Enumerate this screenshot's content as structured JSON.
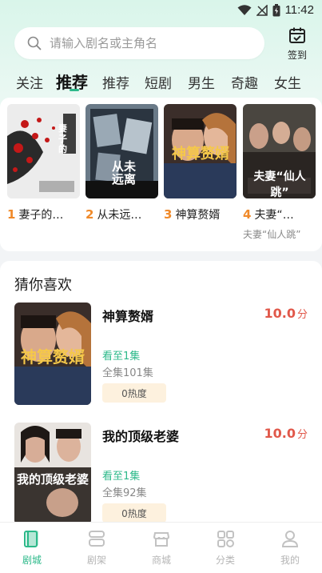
{
  "status": {
    "time": "11:42"
  },
  "search": {
    "placeholder": "请输入剧名或主角名"
  },
  "checkin": {
    "label": "签到"
  },
  "tabs": [
    {
      "label": "关注",
      "active": false
    },
    {
      "label": "推荐",
      "active": true
    },
    {
      "label": "推荐",
      "active": false
    },
    {
      "label": "短剧",
      "active": false
    },
    {
      "label": "男生",
      "active": false
    },
    {
      "label": "奇趣",
      "active": false
    },
    {
      "label": "女生",
      "active": false
    }
  ],
  "recommend": {
    "items": [
      {
        "rank": "1",
        "title": "妻子的…",
        "subtitle": "",
        "cover_text": "妻子的"
      },
      {
        "rank": "2",
        "title": "从未远…",
        "subtitle": "",
        "cover_text": "从未远离"
      },
      {
        "rank": "3",
        "title": "神算赘婿",
        "subtitle": "",
        "cover_text": "神算赘婿"
      },
      {
        "rank": "4",
        "title": "夫妻“…",
        "subtitle": "夫妻“仙人跳”",
        "cover_text": "夫妻“仙人跳”"
      }
    ]
  },
  "guess": {
    "title": "猜你喜欢",
    "items": [
      {
        "name": "神算赘婿",
        "score": "10.0",
        "score_unit": "分",
        "progress": "看至1集",
        "total": "全集101集",
        "heat": "0热度",
        "cover_text": "神算赘婿"
      },
      {
        "name": "我的顶级老婆",
        "score": "10.0",
        "score_unit": "分",
        "progress": "看至1集",
        "total": "全集92集",
        "heat": "0热度",
        "cover_text": "我的顶级老婆"
      }
    ]
  },
  "nav": [
    {
      "label": "剧城",
      "icon": "drama-city-icon",
      "active": true
    },
    {
      "label": "剧架",
      "icon": "bookshelf-icon",
      "active": false
    },
    {
      "label": "商城",
      "icon": "store-icon",
      "active": false
    },
    {
      "label": "分类",
      "icon": "category-icon",
      "active": false
    },
    {
      "label": "我的",
      "icon": "profile-icon",
      "active": false
    }
  ],
  "colors": {
    "accent": "#2db98a",
    "rank": "#f08a2a",
    "score": "#e1584a",
    "heat_bg": "#fdf1de"
  }
}
